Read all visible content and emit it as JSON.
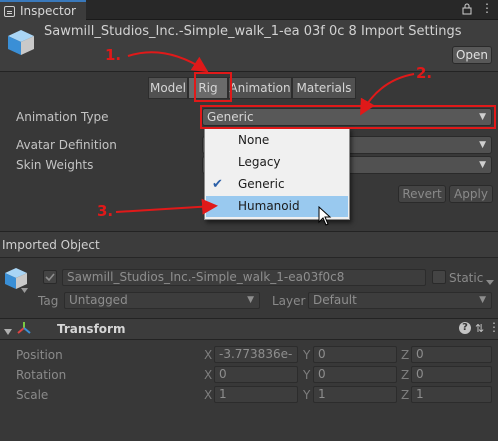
{
  "tab": {
    "label": "Inspector"
  },
  "header": {
    "title": "Sawmill_Studios_Inc.-Simple_walk_1-ea 03f 0c 8 Import Settings",
    "open_label": "Open"
  },
  "tabs": [
    "Model",
    "Rig",
    "Animation",
    "Materials"
  ],
  "rig": {
    "animation_type_label": "Animation Type",
    "animation_type_value": "Generic",
    "avatar_definition_label": "Avatar Definition",
    "skin_weights_label": "Skin Weights",
    "revert_label": "Revert",
    "apply_label": "Apply"
  },
  "popup": {
    "options": [
      "None",
      "Legacy",
      "Generic",
      "Humanoid"
    ],
    "selected": "Generic",
    "highlighted": "Humanoid"
  },
  "annotations": {
    "step1": "1.",
    "step2": "2.",
    "step3": "3."
  },
  "imported": {
    "section_label": "Imported Object",
    "object_name": "Sawmill_Studios_Inc.-Simple_walk_1-ea03f0c8",
    "static_label": "Static",
    "tag_label": "Tag",
    "tag_value": "Untagged",
    "layer_label": "Layer",
    "layer_value": "Default"
  },
  "transform": {
    "title": "Transform",
    "rows": [
      {
        "label": "Position",
        "x": "-3.773836e-",
        "y": "0",
        "z": "0"
      },
      {
        "label": "Rotation",
        "x": "0",
        "y": "0",
        "z": "0"
      },
      {
        "label": "Scale",
        "x": "1",
        "y": "1",
        "z": "1"
      }
    ],
    "axis_x": "X",
    "axis_y": "Y",
    "axis_z": "Z"
  },
  "colors": {
    "annotation": "#e01919",
    "highlight": "#99c9ef",
    "check": "#2a5fa8"
  }
}
